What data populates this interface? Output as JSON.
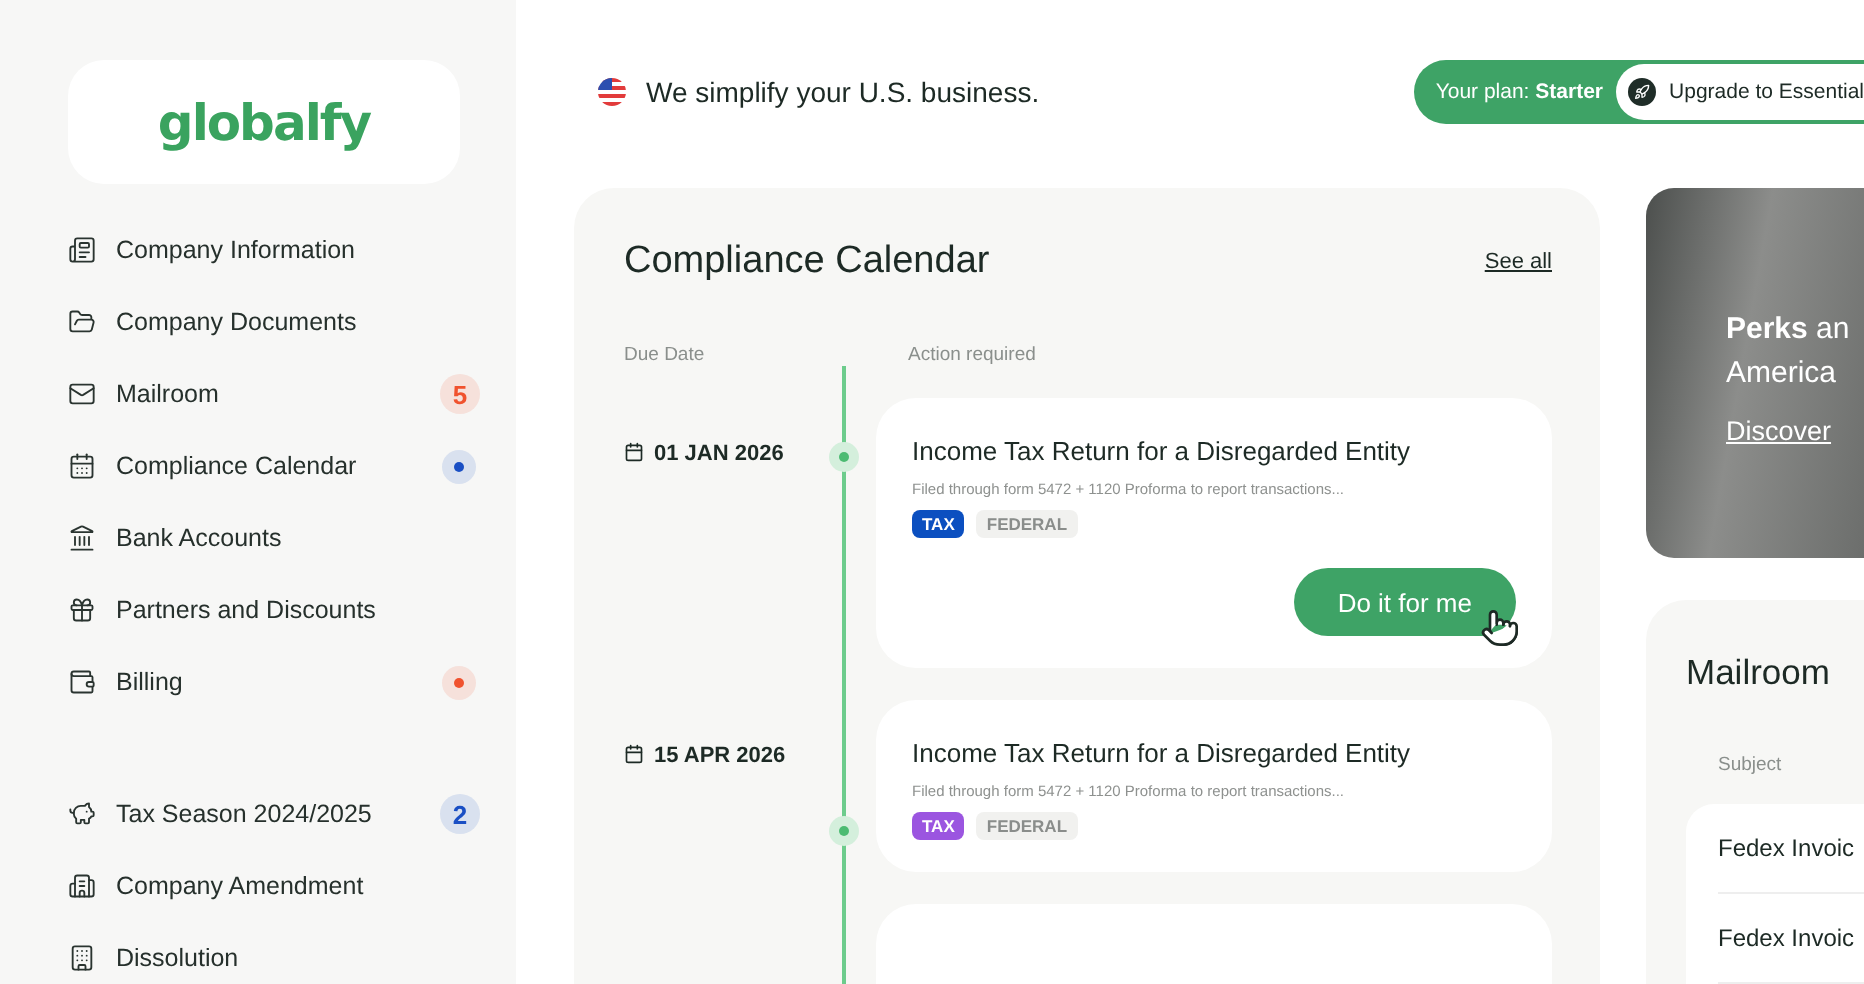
{
  "sidebar": {
    "logo": "globalfy",
    "groups": [
      [
        {
          "label": "Company Information"
        },
        {
          "label": "Company Documents"
        },
        {
          "label": "Mailroom",
          "badge": {
            "kind": "count",
            "text": "5",
            "color": "#f0522e"
          }
        },
        {
          "label": "Compliance Calendar",
          "badge": {
            "kind": "dot",
            "color": "#1a4fc4"
          }
        },
        {
          "label": "Bank Accounts"
        },
        {
          "label": "Partners and Discounts"
        },
        {
          "label": "Billing",
          "badge": {
            "kind": "dot",
            "color": "#f0522e"
          }
        }
      ],
      [
        {
          "label": "Tax Season 2024/2025",
          "badge": {
            "kind": "count",
            "text": "2",
            "color": "#1a4fc4"
          }
        },
        {
          "label": "Company Amendment"
        },
        {
          "label": "Dissolution"
        }
      ]
    ]
  },
  "header": {
    "tagline": "We simplify your U.S. business.",
    "plan_label": "Your plan: **Starter**",
    "upgrade_button": "Upgrade to Essential"
  },
  "calendar": {
    "title": "Compliance Calendar",
    "see_all": "See all",
    "columns": [
      "Due Date",
      "Action required"
    ],
    "entries": [
      {
        "date": "01 JAN 2026",
        "title": "Income Tax Return for a Disregarded Entity",
        "description": "Filed through form 5472 + 1120 Proforma to report transactions...",
        "tags": [
          {
            "kind": "type",
            "text": "TAX",
            "color": "#0b4fc0"
          },
          {
            "kind": "scope",
            "text": "FEDERAL"
          }
        ],
        "action": "Do it for me"
      },
      {
        "date": "15 APR 2026",
        "title": "Income Tax Return for a Disregarded Entity",
        "description": "Filed through form 5472 + 1120 Proforma to report transactions...",
        "tags": [
          {
            "kind": "type",
            "text": "TAX",
            "color": "#9b55e0"
          },
          {
            "kind": "scope",
            "text": "FEDERAL"
          }
        ]
      }
    ]
  },
  "promo": {
    "text": "**Perks** an",
    "text_line_2": "America",
    "link": "Discover"
  },
  "mailroom": {
    "title": "Mailroom",
    "column": "Subject",
    "rows": [
      "Fedex Invoic",
      "Fedex Invoic"
    ]
  }
}
